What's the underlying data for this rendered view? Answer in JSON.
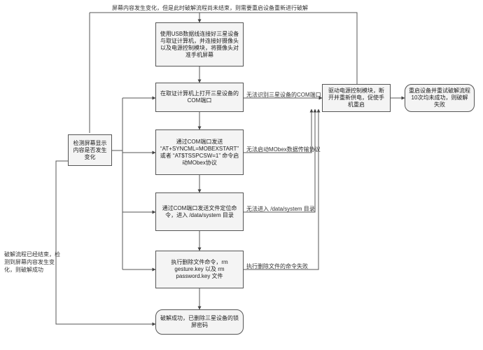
{
  "chart_data": {
    "type": "flowchart",
    "nodes": [
      {
        "id": "n_usb",
        "shape": "rect",
        "text": "使用USB数据线连接好三星设备与取证计算机，并连接好摄像头以及电源控制模块，将摄像头对准手机屏幕"
      },
      {
        "id": "n_com",
        "shape": "rect",
        "text": "在取证计算机上打开三星设备的COM端口"
      },
      {
        "id": "n_mobex",
        "shape": "rect",
        "text": "通过COM端口发送 “AT+SYNCML=MOBEXSTART” 或者 “AT$TSSPCSW=1” 命令启动MObex协议"
      },
      {
        "id": "n_cd",
        "shape": "rect",
        "text": "通过COM端口发送文件定位命令，进入 /data/system 目录"
      },
      {
        "id": "n_rm",
        "shape": "rect",
        "text": "执行删除文件命令，rm gesture.key 以及 rm password.key 文件"
      },
      {
        "id": "n_check",
        "shape": "rect",
        "text": "检测屏幕显示内容是否发生变化"
      },
      {
        "id": "n_power",
        "shape": "rect",
        "text": "驱动电源控制模块，断开并重新供电，促使手机重启"
      },
      {
        "id": "n_retry",
        "shape": "rounded",
        "text": "重启设备并重试破解流程10次均未成功，则破解失败"
      },
      {
        "id": "n_success",
        "shape": "rounded",
        "text": "破解成功，已删除三星设备的锁屏密码"
      }
    ],
    "edges": [
      {
        "from": "n_usb",
        "to": "n_com"
      },
      {
        "from": "n_com",
        "to": "n_mobex"
      },
      {
        "from": "n_mobex",
        "to": "n_cd"
      },
      {
        "from": "n_cd",
        "to": "n_rm"
      },
      {
        "from": "n_rm",
        "to": "n_success"
      },
      {
        "from": "n_com",
        "to": "n_power",
        "label": "无法识别三星设备的COM端口"
      },
      {
        "from": "n_mobex",
        "to": "n_power",
        "label": "无法启动MObex数据传输协议"
      },
      {
        "from": "n_cd",
        "to": "n_power",
        "label": "无法进入 /data/system 目录"
      },
      {
        "from": "n_rm",
        "to": "n_power",
        "label": "执行删除文件的命令失败"
      },
      {
        "from": "n_power",
        "to": "n_retry"
      },
      {
        "from": "n_power",
        "to": "n_usb",
        "label": "屏幕内容发生变化，但是此时破解流程尚未结束，则需要重启设备重新进行破解"
      },
      {
        "from": "n_check",
        "to": "n_com"
      },
      {
        "from": "n_check",
        "to": "n_mobex"
      },
      {
        "from": "n_check",
        "to": "n_cd"
      },
      {
        "from": "n_check",
        "to": "n_rm"
      },
      {
        "from": "n_check",
        "to": "n_success",
        "label": "破解流程已经结束，检测到屏幕内容发生变化，则破解成功"
      }
    ]
  },
  "nodes": {
    "usb": "使用USB数据线连接好三星设备与取证计算机，并连接好摄像头以及电源控制模块，将摄像头对准手机屏幕",
    "com": "在取证计算机上打开三星设备的COM端口",
    "mobex": "通过COM端口发送 “AT+SYNCML=MOBEXSTART” 或者 “AT$TSSPCSW=1” 命令启动MObex协议",
    "cd": "通过COM端口发送文件定位命令，进入 /data/system 目录",
    "rm": "执行删除文件命令，rm gesture.key 以及 rm password.key 文件",
    "check": "检测屏幕显示内容是否发生变化",
    "power": "驱动电源控制模块，断开并重新供电，促使手机重启",
    "retry": "重启设备并重试破解流程10次均未成功，则破解失败",
    "success": "破解成功，已删除三星设备的锁屏密码"
  },
  "labels": {
    "top_loop": "屏幕内容发生变化，但是此时破解流程尚未结束，则需要重启设备重新进行破解",
    "e_com": "无法识别三星设备的COM端口",
    "e_mobex": "无法启动MObex数据传输协议",
    "e_cd": "无法进入 /data/system 目录",
    "e_rm": "执行删除文件的命令失败",
    "left_done": "破解流程已经结束，检测到屏幕内容发生变化，则破解成功"
  }
}
